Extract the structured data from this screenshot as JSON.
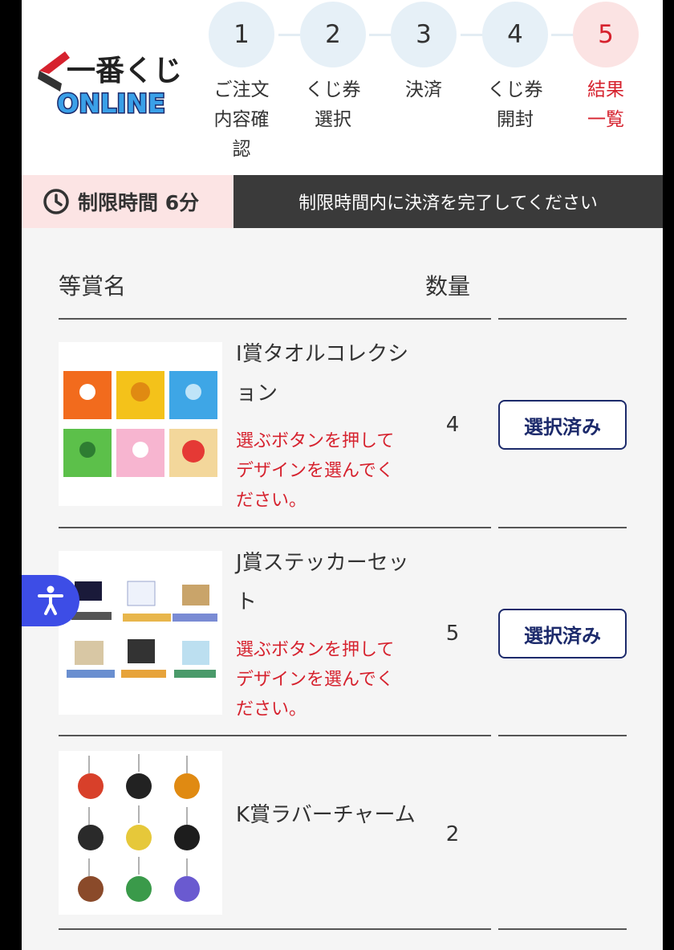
{
  "header": {
    "logo_text_top": "一番くじ",
    "logo_text_bottom": "ONLINE",
    "steps": [
      {
        "num": "1",
        "label": "ご注文\n内容確\n認"
      },
      {
        "num": "2",
        "label": "くじ券\n選択"
      },
      {
        "num": "3",
        "label": "決済"
      },
      {
        "num": "4",
        "label": "くじ券\n開封"
      },
      {
        "num": "5",
        "label": "結果\n一覧"
      }
    ],
    "active_step": 5
  },
  "timer": {
    "text": "制限時間 6分",
    "icon": "clock-icon"
  },
  "notice": "制限時間内に決済を完了してください",
  "table": {
    "headers": {
      "name": "等賞名",
      "qty": "数量"
    },
    "rows": [
      {
        "name": "I賞タオルコレクション",
        "note": "選ぶボタンを押してデザインを選んでください。",
        "qty": "4",
        "button": "選択済み"
      },
      {
        "name": "J賞ステッカーセット",
        "note": "選ぶボタンを押してデザインを選んでください。",
        "qty": "5",
        "button": "選択済み"
      },
      {
        "name": "K賞ラバーチャーム",
        "qty": "2"
      }
    ]
  },
  "colors": {
    "accent_red": "#d6222e",
    "navy": "#1c2a6b",
    "a11y_blue": "#3d4de6",
    "step_bg": "#e6f0f7"
  }
}
